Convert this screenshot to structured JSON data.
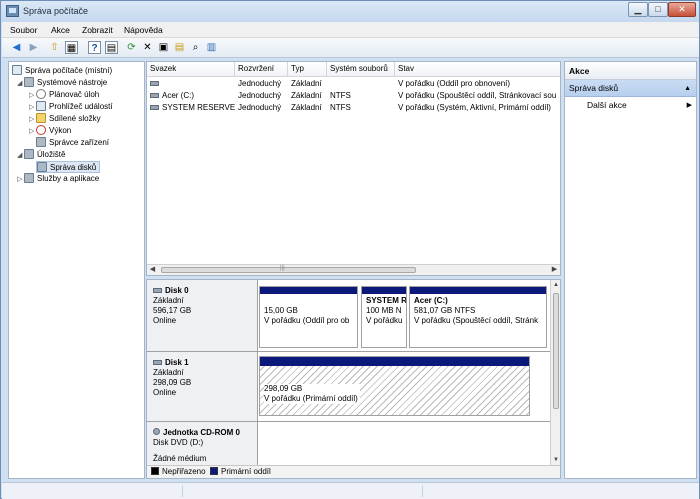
{
  "window": {
    "title": "Správa počítače",
    "min": "▁",
    "max": "□",
    "close": "✕"
  },
  "menu": [
    "Soubor",
    "Akce",
    "Zobrazit",
    "Nápověda"
  ],
  "toolbar": {
    "back": "◀",
    "forward": "▶",
    "up": "⇧",
    "show": "▦",
    "help": "?",
    "view": "▤",
    "refresh": "⟳",
    "delete": "✕",
    "properties": "▣",
    "open": "▤",
    "search": "⌕",
    "filter": "▥"
  },
  "tree": {
    "root": "Správa počítače (místní)",
    "system_tools": "Systémové nástroje",
    "task_scheduler": "Plánovač úloh",
    "event_viewer": "Prohlížeč událostí",
    "shared_folders": "Sdílené složky",
    "performance": "Výkon",
    "device_manager": "Správce zařízení",
    "storage": "Úložiště",
    "disk_management": "Správa disků",
    "services": "Služby a aplikace"
  },
  "volumes": {
    "columns": [
      "Svazek",
      "Rozvržení",
      "Typ",
      "Systém souborů",
      "Stav"
    ],
    "rows": [
      {
        "name": "",
        "layout": "Jednoduchý",
        "type": "Základní",
        "fs": "",
        "status": "V pořádku (Oddíl pro obnovení)"
      },
      {
        "name": "Acer (C:)",
        "layout": "Jednoduchý",
        "type": "Základní",
        "fs": "NTFS",
        "status": "V pořádku (Spouštěcí oddíl, Stránkovací sou"
      },
      {
        "name": "SYSTEM RESERVED",
        "layout": "Jednoduchý",
        "type": "Základní",
        "fs": "NTFS",
        "status": "V pořádku (Systém, Aktivní, Primární oddíl)"
      }
    ],
    "scroll_left": "◀",
    "scroll_right": "▶",
    "grip": "|||"
  },
  "disks": {
    "disk0": {
      "name": "Disk 0",
      "type": "Základní",
      "size": "596,17 GB",
      "state": "Online",
      "parts": [
        {
          "title": "",
          "size": "15,00 GB",
          "status": "V pořádku (Oddíl pro ob"
        },
        {
          "title": "SYSTEM R",
          "size": "100 MB N",
          "status": "V pořádku"
        },
        {
          "title": "Acer  (C:)",
          "size": "581,07 GB NTFS",
          "status": "V pořádku (Spouštěcí oddíl, Stránk"
        }
      ]
    },
    "disk1": {
      "name": "Disk 1",
      "type": "Základní",
      "size": "298,09 GB",
      "state": "Online",
      "part": {
        "size": "298,09 GB",
        "status": "V pořádku (Primární oddíl)"
      }
    },
    "cdrom": {
      "name": "Jednotka CD-ROM 0",
      "type": "Disk DVD (D:)",
      "extra": "Žádné médium"
    },
    "legend": {
      "unallocated": "Nepřiřazeno",
      "primary": "Primární oddíl"
    },
    "colors": {
      "primary": "#0b1a7a",
      "unallocated": "#000000"
    },
    "scroll_up": "▲",
    "scroll_down": "▼"
  },
  "actions": {
    "header": "Akce",
    "section": "Správa disků",
    "collapse": "▲",
    "more": "Další akce",
    "more_arrow": "▶"
  }
}
